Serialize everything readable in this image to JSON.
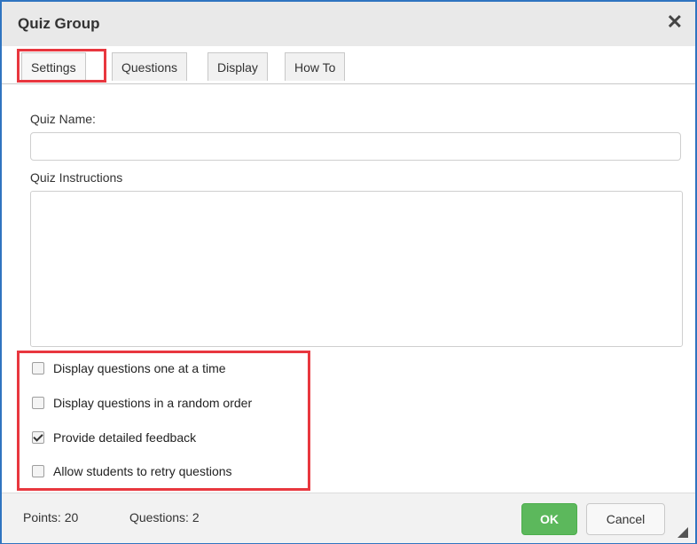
{
  "dialog": {
    "title": "Quiz Group",
    "close_icon": "close-icon"
  },
  "tabs": [
    {
      "label": "Settings",
      "active": true
    },
    {
      "label": "Questions",
      "active": false
    },
    {
      "label": "Display",
      "active": false
    },
    {
      "label": "How To",
      "active": false
    }
  ],
  "settings": {
    "quiz_name_label": "Quiz Name:",
    "quiz_name_value": "",
    "quiz_instructions_label": "Quiz Instructions",
    "quiz_instructions_value": "",
    "options": [
      {
        "label": "Display questions one at a time",
        "checked": false
      },
      {
        "label": "Display questions in a random order",
        "checked": false
      },
      {
        "label": "Provide detailed feedback",
        "checked": true
      },
      {
        "label": "Allow students to retry questions",
        "checked": false
      }
    ]
  },
  "footer": {
    "points": "Points: 20",
    "questions": "Questions: 2",
    "ok_label": "OK",
    "cancel_label": "Cancel",
    "resize_icon": "resize-grip-icon"
  },
  "colors": {
    "highlight": "#e8373f",
    "ok_button": "#5cb85c",
    "border": "#2f74c0"
  }
}
